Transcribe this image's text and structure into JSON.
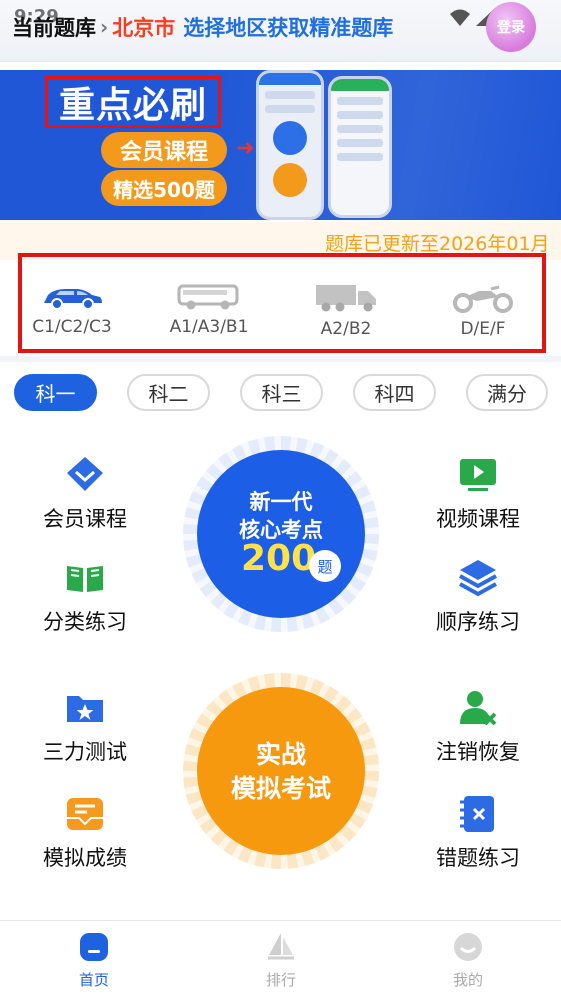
{
  "status": {
    "time": "9:29"
  },
  "header": {
    "label": "当前题库",
    "city": "北京市",
    "hint": "选择地区获取精准题库",
    "login_label": "登录"
  },
  "banner": {
    "title": "重点必刷",
    "pill_1": "会员课程",
    "pill_2": "精选500题"
  },
  "notice": {
    "text": "题库已更新至2026年01月"
  },
  "license_types": [
    {
      "label": "C1/C2/C3",
      "icon": "car-icon"
    },
    {
      "label": "A1/A3/B1",
      "icon": "bus-icon"
    },
    {
      "label": "A2/B2",
      "icon": "truck-icon"
    },
    {
      "label": "D/E/F",
      "icon": "motorcycle-icon"
    }
  ],
  "subject_tabs": [
    {
      "label": "科一",
      "active": true
    },
    {
      "label": "科二",
      "active": false
    },
    {
      "label": "科三",
      "active": false
    },
    {
      "label": "科四",
      "active": false
    },
    {
      "label": "满分",
      "active": false
    }
  ],
  "features": {
    "member_course": "会员课程",
    "video_course": "视频课程",
    "category_practice": "分类练习",
    "sequential_practice": "顺序练习",
    "three_ability_test": "三力测试",
    "cancel_restore": "注销恢复",
    "mock_score": "模拟成绩",
    "wrong_question_practice": "错题练习"
  },
  "core_points": {
    "line1": "新一代",
    "line2": "核心考点",
    "count": "200",
    "unit": "题"
  },
  "mock_exam": {
    "line1": "实战",
    "line2": "模拟考试"
  },
  "bottom_nav": [
    {
      "label": "首页",
      "active": true
    },
    {
      "label": "排行",
      "active": false
    },
    {
      "label": "我的",
      "active": false
    }
  ],
  "colors": {
    "primary": "#1f62e0",
    "accent": "#f7990f",
    "city": "#ff3b1f",
    "notice": "#f3a21a",
    "highlight_border": "#e01515"
  }
}
